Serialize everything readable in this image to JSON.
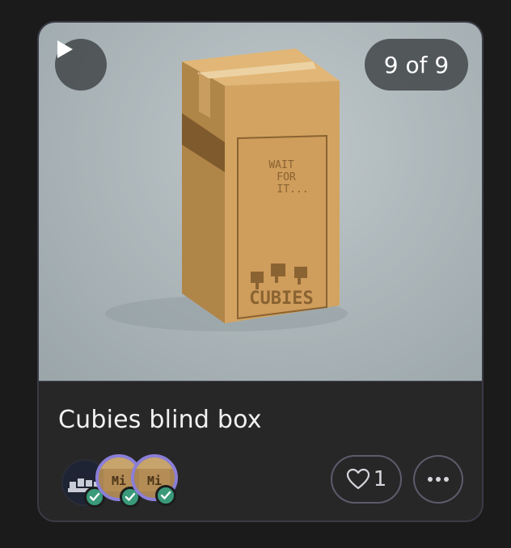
{
  "card": {
    "counter_text": "9 of 9",
    "title": "Cubies blind box",
    "likes_count": "1",
    "box_text": {
      "wait_line1": "WAIT",
      "wait_line2": "FOR",
      "wait_line3": "IT...",
      "brand": "CUBIES"
    },
    "avatars": [
      {
        "name": "owner-avatar",
        "verified": true
      },
      {
        "name": "collection-avatar-1",
        "label": "Mi",
        "verified": true
      },
      {
        "name": "collection-avatar-2",
        "label": "Mi",
        "verified": true
      }
    ],
    "icons": {
      "play": "play-icon",
      "heart": "heart-icon",
      "more": "more-icon",
      "verified": "check-icon"
    },
    "colors": {
      "background": "#1b1b1c",
      "card": "#272728",
      "accent_ring": "#8b7fd8",
      "verified": "#3a9a7a"
    }
  }
}
